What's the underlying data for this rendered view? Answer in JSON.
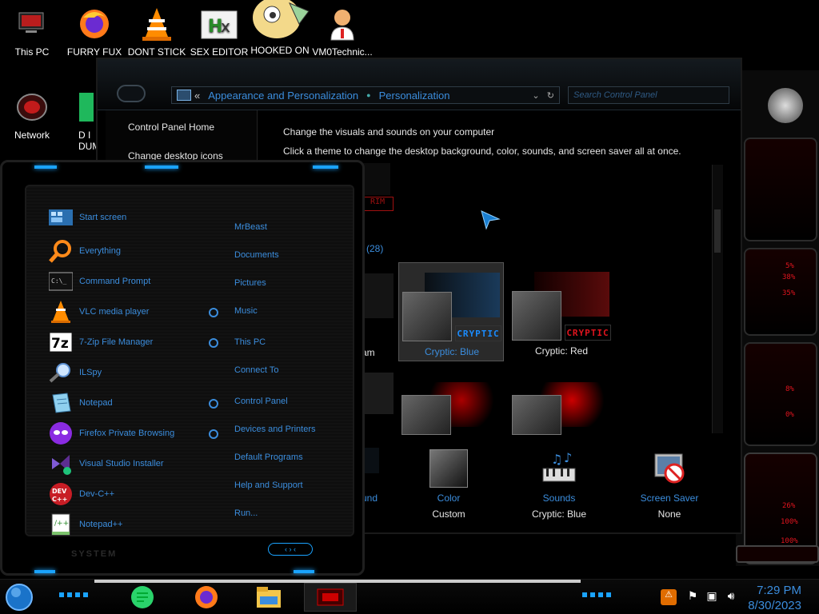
{
  "desktop": {
    "icons": [
      {
        "label": "This PC",
        "icon": "this-pc-icon"
      },
      {
        "label": "FURRY FUX",
        "icon": "firefox-icon"
      },
      {
        "label": "DONT STICK",
        "icon": "vlc-cone-icon"
      },
      {
        "label": "SEX EDITOR",
        "icon": "hex-editor-icon"
      },
      {
        "label": "HOOKED ON",
        "icon": "cartoon-character-icon"
      },
      {
        "label": "VM0Technic...",
        "icon": "doctor-avatar-icon"
      },
      {
        "label": "Network",
        "icon": "network-icon"
      },
      {
        "label": "D I DUM",
        "icon": "green-document-icon"
      }
    ]
  },
  "control_panel": {
    "address": {
      "back_chevrons": "«",
      "crumbs": [
        "Appearance and Personalization",
        "Personalization"
      ]
    },
    "search_placeholder": "Search Control Panel",
    "sidebar": {
      "links": [
        "Control Panel Home",
        "Change desktop icons"
      ]
    },
    "main": {
      "heading": "Change the visuals and sounds on your computer",
      "subheading": "Click a theme to change the desktop background, color, sounds, and screen saver all at once.",
      "count_label": "(28)",
      "partial_label": "am",
      "themes": [
        {
          "name": "Cryptic: Blue",
          "brand": "CRYPTIC",
          "brand_color": "#1a8cff",
          "selected": true
        },
        {
          "name": "Cryptic: Red",
          "brand": "CRYPTIC",
          "brand_color": "#e0141e",
          "selected": false
        }
      ]
    },
    "bottom": {
      "partial_label": "und",
      "items": [
        {
          "title": "Color",
          "value": "Custom",
          "icon": "color-swatch-icon"
        },
        {
          "title": "Sounds",
          "value": "Cryptic: Blue",
          "icon": "sounds-icon"
        },
        {
          "title": "Screen Saver",
          "value": "None",
          "icon": "screen-saver-icon"
        }
      ]
    }
  },
  "start_menu": {
    "programs": [
      {
        "label": "Start screen",
        "icon": "start-screen-icon"
      },
      {
        "label": "Everything",
        "icon": "everything-search-icon"
      },
      {
        "label": "Command Prompt",
        "icon": "command-prompt-icon"
      },
      {
        "label": "VLC media player",
        "icon": "vlc-icon"
      },
      {
        "label": "7-Zip File Manager",
        "icon": "7zip-icon"
      },
      {
        "label": "ILSpy",
        "icon": "ilspy-icon"
      },
      {
        "label": "Notepad",
        "icon": "notepad-icon"
      },
      {
        "label": "Firefox Private Browsing",
        "icon": "firefox-private-icon"
      },
      {
        "label": "Visual Studio Installer",
        "icon": "visual-studio-installer-icon"
      },
      {
        "label": "Dev-C++",
        "icon": "dev-cpp-icon"
      },
      {
        "label": "Notepad++",
        "icon": "notepad-plus-plus-icon"
      }
    ],
    "places": [
      {
        "label": "MrBeast",
        "dot": false
      },
      {
        "label": "Documents",
        "dot": false
      },
      {
        "label": "Pictures",
        "dot": false
      },
      {
        "label": "Music",
        "dot": true
      },
      {
        "label": "This PC",
        "dot": true
      },
      {
        "label": "Connect To",
        "dot": false
      },
      {
        "label": "Control Panel",
        "dot": true
      },
      {
        "label": "Devices and Printers",
        "dot": true
      },
      {
        "label": "Default Programs",
        "dot": false
      },
      {
        "label": "Help and Support",
        "dot": false
      },
      {
        "label": "Run...",
        "dot": false
      }
    ],
    "system_label": "SYSTEM"
  },
  "taskbar": {
    "apps": [
      "start-orb-icon",
      "notes-app-icon",
      "firefox-icon",
      "file-explorer-icon",
      "control-panel-app-icon"
    ],
    "tray": [
      "bonjour-icon",
      "flag-icon",
      "network-tray-icon",
      "volume-icon"
    ],
    "time": "7:29 PM",
    "date": "8/30/2023"
  },
  "colors": {
    "accent": "#3b8ddd",
    "hud_red": "#e0141e",
    "glow_blue": "#1aa3ff"
  }
}
